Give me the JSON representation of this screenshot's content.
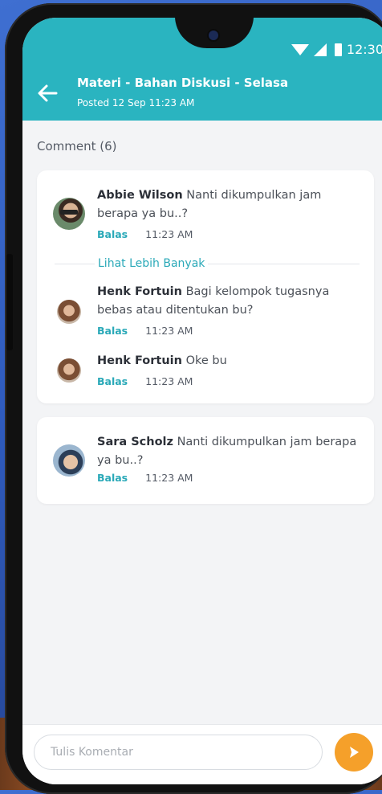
{
  "status": {
    "time": "12:30"
  },
  "header": {
    "title": "Materi - Bahan Diskusi - Selasa",
    "subtitle": "Posted 12 Sep 11:23 AM"
  },
  "comments_header": "Comment (6)",
  "thread1": {
    "main": {
      "name": "Abbie Wilson",
      "text_line1": "Nanti dikumpulkan jam",
      "text_line2": "berapa ya bu..?",
      "reply": "Balas",
      "time": "11:23 AM"
    },
    "more_label": "Lihat Lebih Banyak",
    "replies": [
      {
        "name": "Henk Fortuin",
        "text_line1": "Bagi kelompok tugasnya",
        "text_line2": "bebas atau ditentukan bu?",
        "reply": "Balas",
        "time": "11:23 AM"
      },
      {
        "name": "Henk Fortuin",
        "text_line1": "Oke bu",
        "reply": "Balas",
        "time": "11:23 AM"
      }
    ]
  },
  "thread2": {
    "main": {
      "name": "Sara Scholz",
      "text_line1": "Nanti dikumpulkan jam berapa",
      "text_line2": "ya bu..?",
      "reply": "Balas",
      "time": "11:23 AM"
    }
  },
  "composer": {
    "placeholder": "Tulis Komentar"
  },
  "colors": {
    "primary": "#2ab4c0",
    "accent": "#f5a02a"
  }
}
